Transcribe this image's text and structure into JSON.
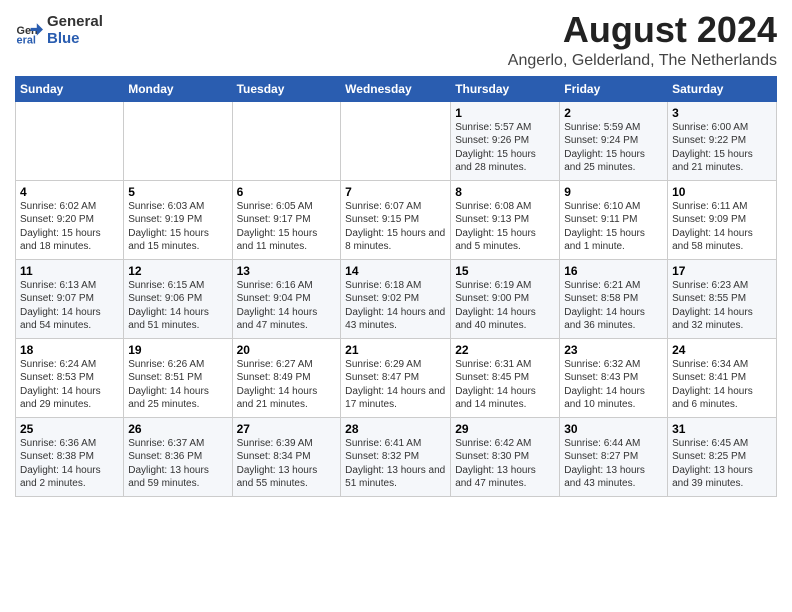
{
  "logo": {
    "general": "General",
    "blue": "Blue"
  },
  "calendar": {
    "title": "August 2024",
    "subtitle": "Angerlo, Gelderland, The Netherlands",
    "headers": [
      "Sunday",
      "Monday",
      "Tuesday",
      "Wednesday",
      "Thursday",
      "Friday",
      "Saturday"
    ],
    "weeks": [
      [
        {
          "day": "",
          "info": ""
        },
        {
          "day": "",
          "info": ""
        },
        {
          "day": "",
          "info": ""
        },
        {
          "day": "",
          "info": ""
        },
        {
          "day": "1",
          "info": "Sunrise: 5:57 AM\nSunset: 9:26 PM\nDaylight: 15 hours\nand 28 minutes."
        },
        {
          "day": "2",
          "info": "Sunrise: 5:59 AM\nSunset: 9:24 PM\nDaylight: 15 hours\nand 25 minutes."
        },
        {
          "day": "3",
          "info": "Sunrise: 6:00 AM\nSunset: 9:22 PM\nDaylight: 15 hours\nand 21 minutes."
        }
      ],
      [
        {
          "day": "4",
          "info": "Sunrise: 6:02 AM\nSunset: 9:20 PM\nDaylight: 15 hours\nand 18 minutes."
        },
        {
          "day": "5",
          "info": "Sunrise: 6:03 AM\nSunset: 9:19 PM\nDaylight: 15 hours\nand 15 minutes."
        },
        {
          "day": "6",
          "info": "Sunrise: 6:05 AM\nSunset: 9:17 PM\nDaylight: 15 hours\nand 11 minutes."
        },
        {
          "day": "7",
          "info": "Sunrise: 6:07 AM\nSunset: 9:15 PM\nDaylight: 15 hours\nand 8 minutes."
        },
        {
          "day": "8",
          "info": "Sunrise: 6:08 AM\nSunset: 9:13 PM\nDaylight: 15 hours\nand 5 minutes."
        },
        {
          "day": "9",
          "info": "Sunrise: 6:10 AM\nSunset: 9:11 PM\nDaylight: 15 hours\nand 1 minute."
        },
        {
          "day": "10",
          "info": "Sunrise: 6:11 AM\nSunset: 9:09 PM\nDaylight: 14 hours\nand 58 minutes."
        }
      ],
      [
        {
          "day": "11",
          "info": "Sunrise: 6:13 AM\nSunset: 9:07 PM\nDaylight: 14 hours\nand 54 minutes."
        },
        {
          "day": "12",
          "info": "Sunrise: 6:15 AM\nSunset: 9:06 PM\nDaylight: 14 hours\nand 51 minutes."
        },
        {
          "day": "13",
          "info": "Sunrise: 6:16 AM\nSunset: 9:04 PM\nDaylight: 14 hours\nand 47 minutes."
        },
        {
          "day": "14",
          "info": "Sunrise: 6:18 AM\nSunset: 9:02 PM\nDaylight: 14 hours\nand 43 minutes."
        },
        {
          "day": "15",
          "info": "Sunrise: 6:19 AM\nSunset: 9:00 PM\nDaylight: 14 hours\nand 40 minutes."
        },
        {
          "day": "16",
          "info": "Sunrise: 6:21 AM\nSunset: 8:58 PM\nDaylight: 14 hours\nand 36 minutes."
        },
        {
          "day": "17",
          "info": "Sunrise: 6:23 AM\nSunset: 8:55 PM\nDaylight: 14 hours\nand 32 minutes."
        }
      ],
      [
        {
          "day": "18",
          "info": "Sunrise: 6:24 AM\nSunset: 8:53 PM\nDaylight: 14 hours\nand 29 minutes."
        },
        {
          "day": "19",
          "info": "Sunrise: 6:26 AM\nSunset: 8:51 PM\nDaylight: 14 hours\nand 25 minutes."
        },
        {
          "day": "20",
          "info": "Sunrise: 6:27 AM\nSunset: 8:49 PM\nDaylight: 14 hours\nand 21 minutes."
        },
        {
          "day": "21",
          "info": "Sunrise: 6:29 AM\nSunset: 8:47 PM\nDaylight: 14 hours\nand 17 minutes."
        },
        {
          "day": "22",
          "info": "Sunrise: 6:31 AM\nSunset: 8:45 PM\nDaylight: 14 hours\nand 14 minutes."
        },
        {
          "day": "23",
          "info": "Sunrise: 6:32 AM\nSunset: 8:43 PM\nDaylight: 14 hours\nand 10 minutes."
        },
        {
          "day": "24",
          "info": "Sunrise: 6:34 AM\nSunset: 8:41 PM\nDaylight: 14 hours\nand 6 minutes."
        }
      ],
      [
        {
          "day": "25",
          "info": "Sunrise: 6:36 AM\nSunset: 8:38 PM\nDaylight: 14 hours\nand 2 minutes."
        },
        {
          "day": "26",
          "info": "Sunrise: 6:37 AM\nSunset: 8:36 PM\nDaylight: 13 hours\nand 59 minutes."
        },
        {
          "day": "27",
          "info": "Sunrise: 6:39 AM\nSunset: 8:34 PM\nDaylight: 13 hours\nand 55 minutes."
        },
        {
          "day": "28",
          "info": "Sunrise: 6:41 AM\nSunset: 8:32 PM\nDaylight: 13 hours\nand 51 minutes."
        },
        {
          "day": "29",
          "info": "Sunrise: 6:42 AM\nSunset: 8:30 PM\nDaylight: 13 hours\nand 47 minutes."
        },
        {
          "day": "30",
          "info": "Sunrise: 6:44 AM\nSunset: 8:27 PM\nDaylight: 13 hours\nand 43 minutes."
        },
        {
          "day": "31",
          "info": "Sunrise: 6:45 AM\nSunset: 8:25 PM\nDaylight: 13 hours\nand 39 minutes."
        }
      ]
    ]
  }
}
